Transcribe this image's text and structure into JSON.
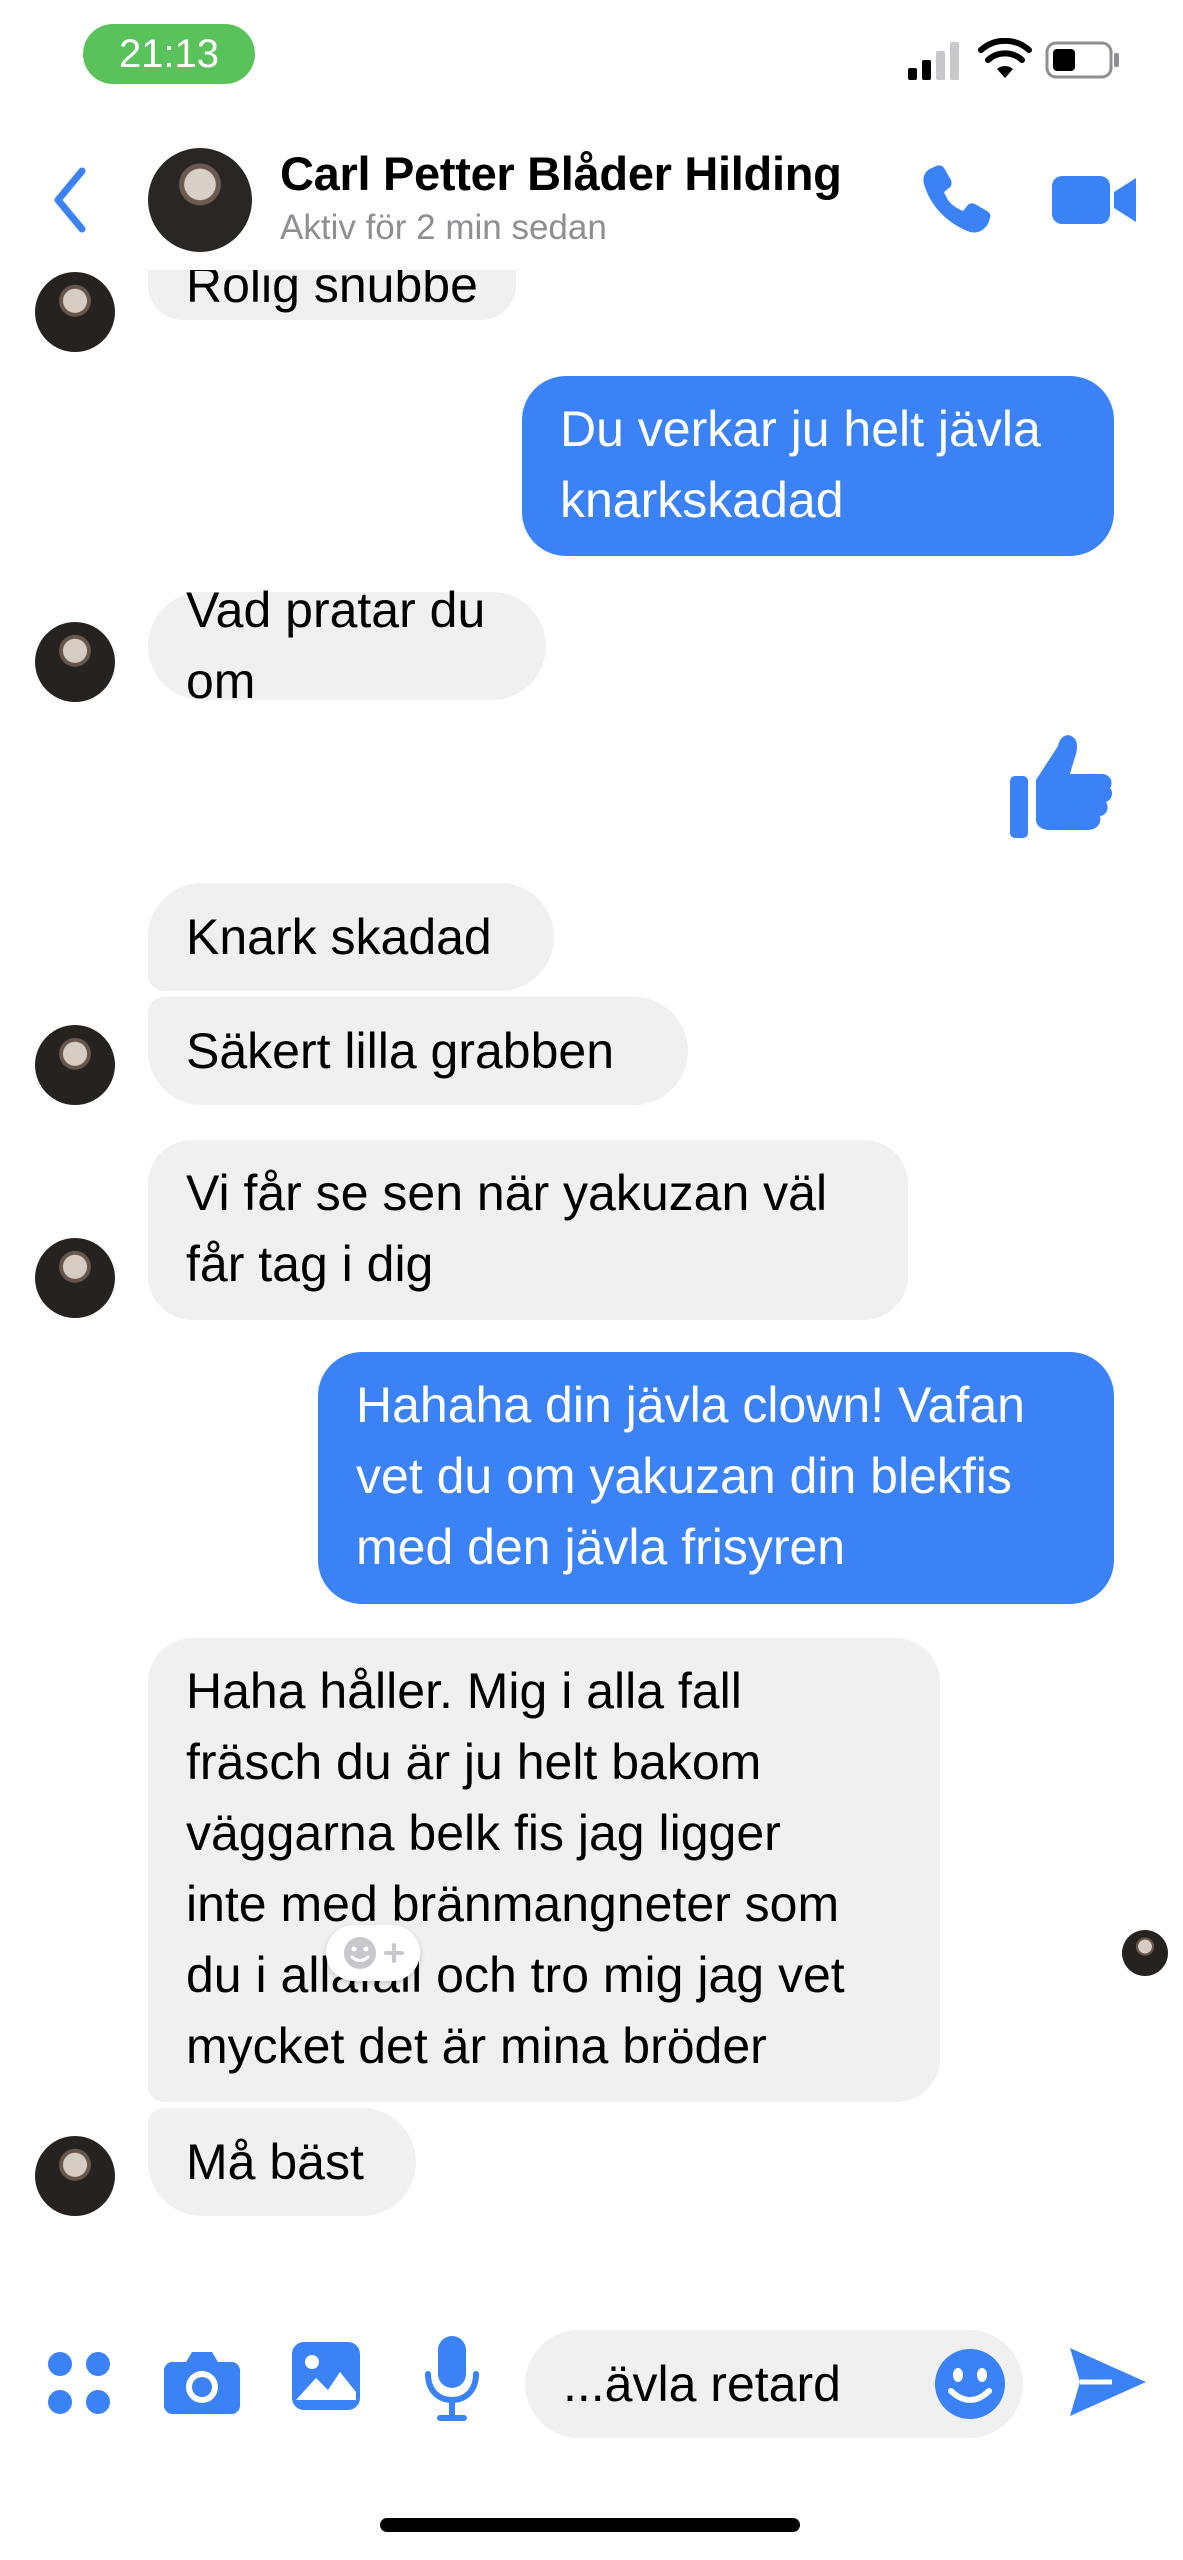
{
  "status_bar": {
    "time": "21:13"
  },
  "header": {
    "contact_name": "Carl Petter Blåder Hilding",
    "contact_status": "Aktiv för 2 min sedan"
  },
  "messages": [
    {
      "direction": "in",
      "text": "Rolig snubbe"
    },
    {
      "direction": "out",
      "lines": [
        "Du verkar ju helt jävla",
        "knarkskadad"
      ]
    },
    {
      "direction": "in",
      "text": "Vad pratar du om"
    },
    {
      "direction": "out",
      "type": "like"
    },
    {
      "direction": "in",
      "text": "Knark skadad"
    },
    {
      "direction": "in",
      "text": "Säkert lilla grabben"
    },
    {
      "direction": "in",
      "lines": [
        "Vi får se sen när yakuzan väl",
        "får tag i dig"
      ]
    },
    {
      "direction": "out",
      "lines": [
        "Hahaha din jävla clown! Vafan",
        "vet du om yakuzan din blekfis",
        "med den jävla frisyren"
      ]
    },
    {
      "direction": "in",
      "lines": [
        "Haha håller. Mig i alla fall",
        "fräsch du är ju helt bakom",
        "väggarna belk fis jag ligger",
        "inte med bränmangneter som",
        "du i allafall och tro mig jag vet",
        "mycket det är mina bröder"
      ]
    },
    {
      "direction": "in",
      "text": "Må bäst"
    }
  ],
  "composer": {
    "input_value": "...ävla retard"
  },
  "colors": {
    "accent": "#3b82f6",
    "incoming_bubble": "#f0f0f0",
    "active_green": "#5ac25a"
  }
}
